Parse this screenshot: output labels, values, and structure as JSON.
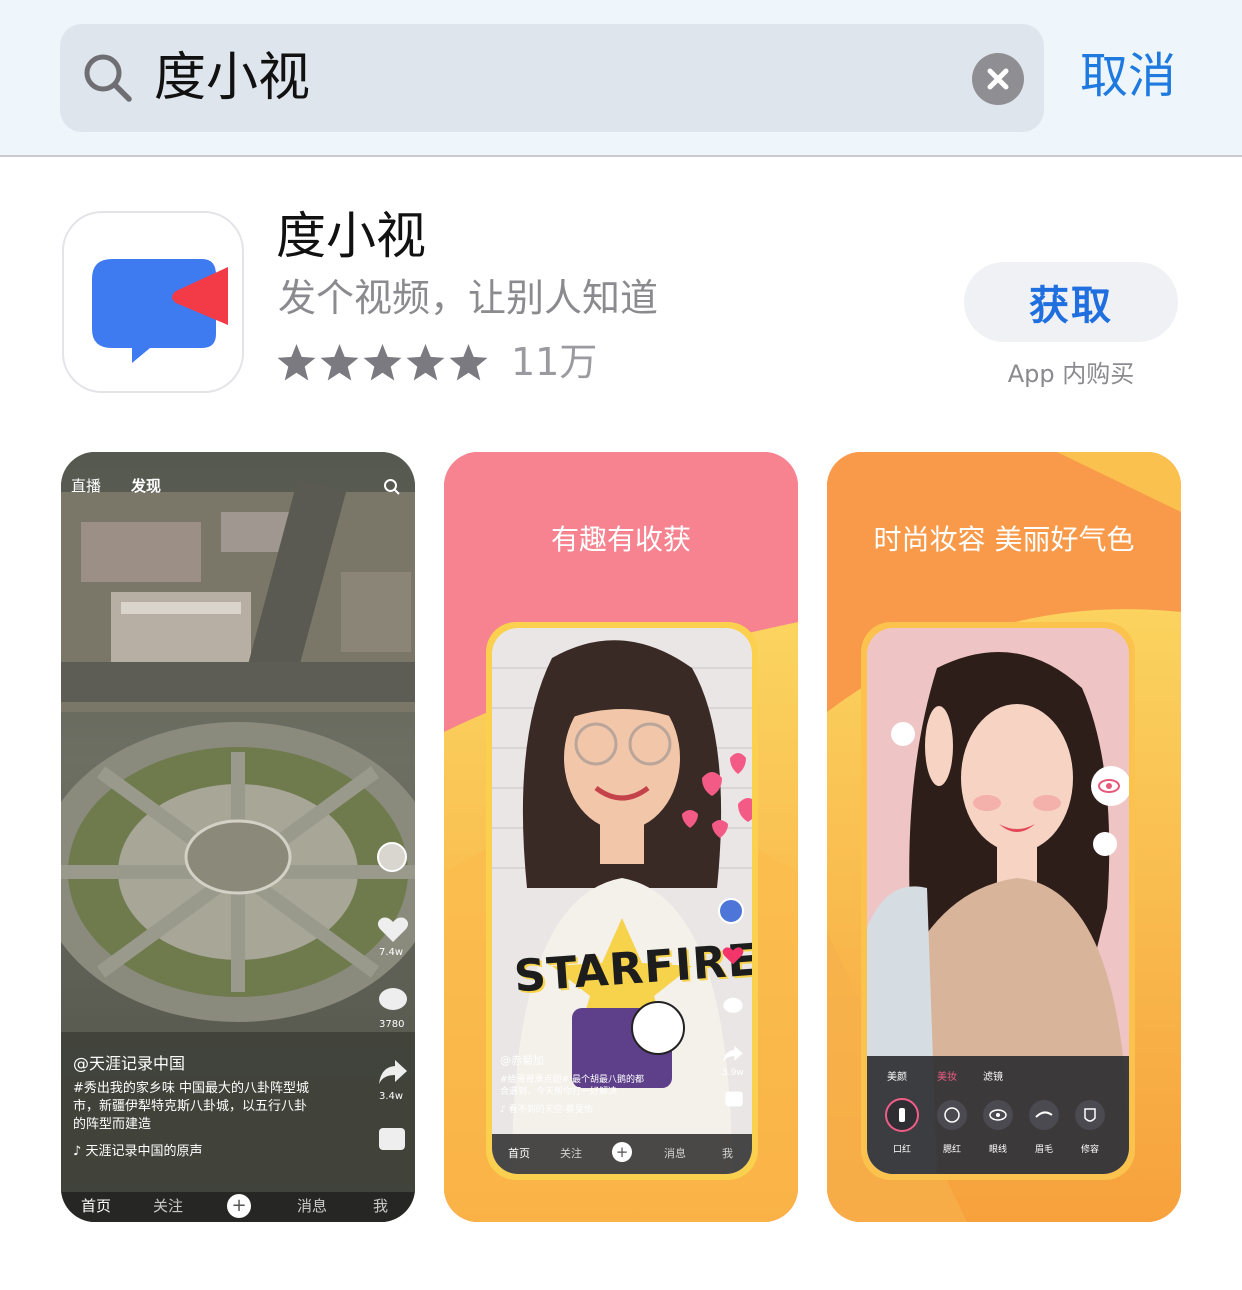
{
  "search": {
    "query": "度小视",
    "cancel_label": "取消"
  },
  "app": {
    "name": "度小视",
    "subtitle": "发个视频，让别人知道",
    "rating_stars": 5,
    "rating_count": "11万",
    "get_label": "获取",
    "iap_note": "App 内购买"
  },
  "screenshots": [
    {
      "top_tabs": [
        "直播",
        "发现"
      ],
      "author": "@天涯记录中国",
      "description_lines": [
        "#秀出我的家乡味 中国最大的八卦阵型城",
        "市，新疆伊犁特克斯八卦城，以五行八卦",
        "的阵型而建造"
      ],
      "music": "天涯记录中国的原声",
      "counts": [
        "7.4w",
        "3780",
        "3.4w"
      ],
      "nav": [
        "首页",
        "关注",
        "",
        "消息",
        "我"
      ]
    },
    {
      "caption": "有趣有收获",
      "shirt_text": "STARFIRE",
      "author": "@赤菊加",
      "description_lines": [
        "#给哥哥承点题# 最个胡最八鹅的都",
        "合遇到，今天帮你打一好解决"
      ],
      "music": "看不到的天空-蔡旻佑",
      "counts": [
        "3.9w"
      ],
      "nav": [
        "首页",
        "关注",
        "",
        "消息",
        "我"
      ]
    },
    {
      "caption": "时尚妆容 美丽好气色",
      "tabs": [
        "美颜",
        "美妆",
        "滤镜"
      ],
      "tools": [
        "口红",
        "腮红",
        "眼线",
        "眉毛",
        "修容"
      ]
    }
  ],
  "colors": {
    "accent_blue": "#1f7ae0",
    "icon_blue": "#3f7bf0",
    "icon_red": "#f23b47",
    "screenshot2_pink": "#f6838f",
    "screenshot3_orange": "#f89a4a"
  }
}
